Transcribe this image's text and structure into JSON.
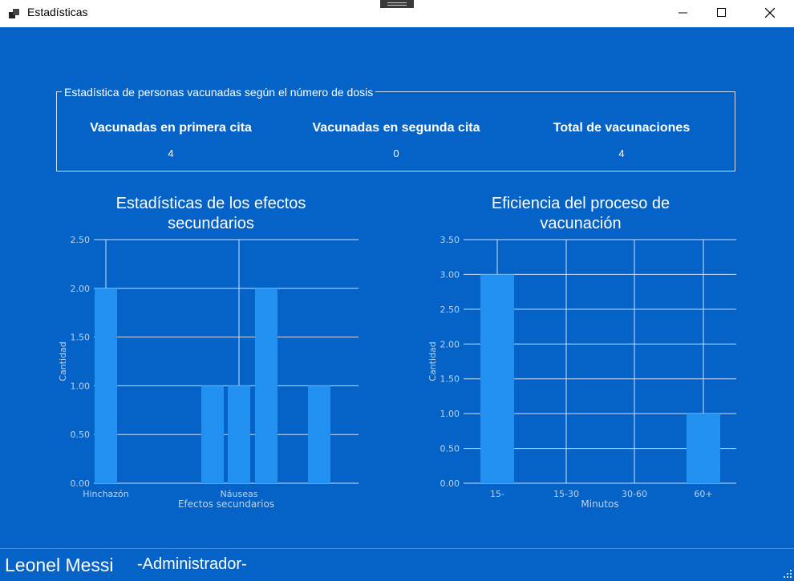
{
  "window": {
    "title": "Estadísticas"
  },
  "colors": {
    "background": "#0563c7",
    "bar": "#2190f0",
    "grid": "#cfe0f7",
    "axis_text": "#b9d3f3"
  },
  "stats": {
    "legend": "Estadística de personas vacunadas según el número de dosis",
    "items": [
      {
        "label": "Vacunadas en primera cita",
        "value": "4"
      },
      {
        "label": "Vacunadas en segunda cita",
        "value": "0"
      },
      {
        "label": "Total de vacunaciones",
        "value": "4"
      }
    ]
  },
  "chart_data": [
    {
      "type": "bar",
      "title": "Estadísticas de los efectos secundarios",
      "xlabel": "Efectos secundarios",
      "ylabel": "Cantidad",
      "ylim": [
        0,
        2.5
      ],
      "yticks": [
        "0.00",
        "0.50",
        "1.00",
        "1.50",
        "2.00",
        "2.50"
      ],
      "x_tick_labels": [
        "Hinchazón",
        "Náuseas"
      ],
      "values": [
        2,
        1,
        1,
        2,
        1
      ],
      "grid": true
    },
    {
      "type": "bar",
      "title": "Eficiencia del proceso de vacunación",
      "xlabel": "Minutos",
      "ylabel": "Cantidad",
      "ylim": [
        0,
        3.5
      ],
      "yticks": [
        "0.00",
        "0.50",
        "1.00",
        "1.50",
        "2.00",
        "2.50",
        "3.00",
        "3.50"
      ],
      "categories": [
        "15-",
        "15-30",
        "30-60",
        "60+"
      ],
      "values": [
        3,
        0,
        0,
        1
      ],
      "grid": true
    }
  ],
  "footer": {
    "user_name": "Leonel Messi",
    "role": "-Administrador-"
  },
  "icons": {
    "app": "window-icon",
    "minimize": "minimize-icon",
    "maximize": "maximize-icon",
    "close": "close-icon"
  }
}
